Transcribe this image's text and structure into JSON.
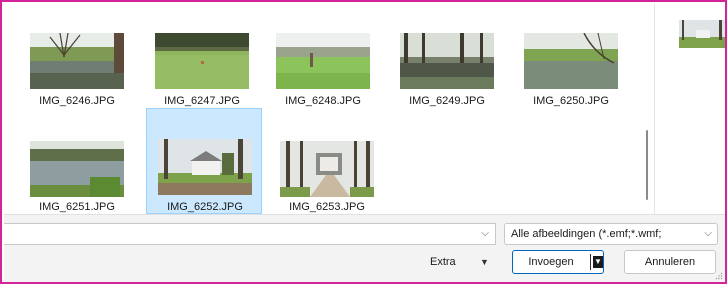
{
  "files": [
    {
      "name": "IMG_6246.JPG",
      "selected": false,
      "scene": "pond-tree"
    },
    {
      "name": "IMG_6247.JPG",
      "selected": false,
      "scene": "meadow"
    },
    {
      "name": "IMG_6248.JPG",
      "selected": false,
      "scene": "field-post"
    },
    {
      "name": "IMG_6249.JPG",
      "selected": false,
      "scene": "forest-water"
    },
    {
      "name": "IMG_6250.JPG",
      "selected": false,
      "scene": "riverbank"
    },
    {
      "name": "IMG_6251.JPG",
      "selected": false,
      "scene": "pond-reeds"
    },
    {
      "name": "IMG_6252.JPG",
      "selected": true,
      "scene": "house-trees"
    },
    {
      "name": "IMG_6253.JPG",
      "selected": false,
      "scene": "manor-lane"
    }
  ],
  "footer": {
    "filename_value": "",
    "filter_label": "Alle afbeeldingen (*.emf;*.wmf;",
    "extra_label": "Extra",
    "insert_label": "Invoegen",
    "cancel_label": "Annuleren"
  },
  "colors": {
    "frame_border": "#d3239a",
    "selection_bg": "#cce8ff",
    "selection_border": "#99d1ff",
    "primary_border": "#0067c0"
  },
  "icons": {
    "dropdown": "chevron-down-icon",
    "split_arrow": "triangle-down-icon"
  }
}
